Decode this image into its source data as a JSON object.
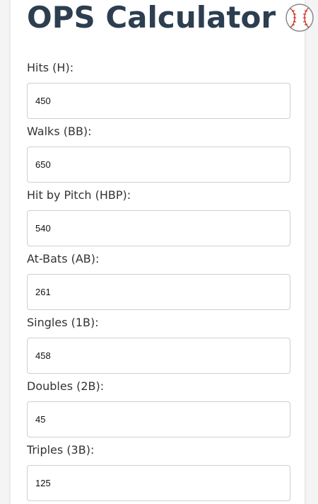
{
  "app": {
    "title": "OPS Calculator",
    "icon": "baseball-icon"
  },
  "fields": [
    {
      "label": "Hits (H):",
      "value": "450"
    },
    {
      "label": "Walks (BB):",
      "value": "650"
    },
    {
      "label": "Hit by Pitch (HBP):",
      "value": "540"
    },
    {
      "label": "At-Bats (AB):",
      "value": "261"
    },
    {
      "label": "Singles (1B):",
      "value": "458"
    },
    {
      "label": "Doubles (2B):",
      "value": "45"
    },
    {
      "label": "Triples (3B):",
      "value": "125"
    }
  ],
  "colors": {
    "title": "#2c3e50",
    "stitch": "#d0392b",
    "border": "#cfcfcf"
  }
}
